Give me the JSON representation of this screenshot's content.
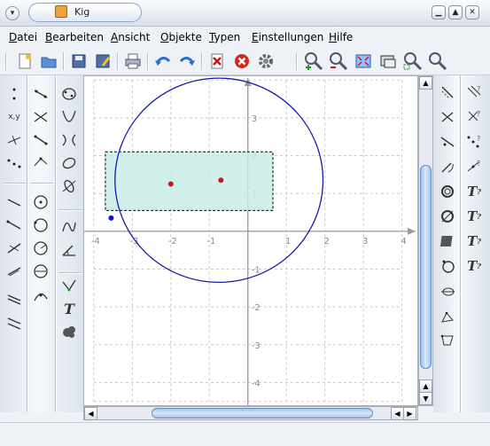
{
  "window": {
    "title": "Kig",
    "controls": [
      "minimize-icon",
      "maximize-icon",
      "close-icon"
    ]
  },
  "menu": [
    "Datei",
    "Bearbeiten",
    "Ansicht",
    "Objekte",
    "Typen",
    "Einstellungen",
    "Hilfe"
  ],
  "toolbar": {
    "buttons": [
      "new-document-icon",
      "open-icon",
      "save-icon",
      "save-as-icon",
      "print-icon",
      "undo-icon",
      "redo-icon",
      "delete-objects-icon",
      "cancel-construction-icon",
      "run-macro-icon",
      "zoom-in-icon",
      "zoom-out-icon",
      "full-screen-icon",
      "recenter-icon",
      "zoom-area-icon",
      "zoom-fit-icon"
    ]
  },
  "tool_glyphs": {
    "text_label": "T",
    "coordinates_label": "x,y"
  },
  "colors": {
    "circle": "#1a1aa8",
    "polygon_fill": "#c9ece8",
    "polygon_border": "#000000",
    "point_red": "#d01414",
    "point_blue": "#1414d0",
    "grid": "#c8c8c8",
    "axes": "#9a9a9a"
  },
  "plot": {
    "x_ticks": [
      "-4",
      "-3",
      "-2",
      "-1",
      "1",
      "2",
      "3",
      "4"
    ],
    "y_ticks": [
      "3",
      "2",
      "1",
      "-1",
      "-2",
      "-3",
      "-4"
    ],
    "xlim": [
      -4.25,
      4.4
    ],
    "ylim": [
      -4.6,
      4.1
    ],
    "grid": true,
    "circle": {
      "cx": -0.75,
      "cy": 1.35,
      "r": 2.7
    },
    "rectangle": {
      "x1": -3.7,
      "y1": 0.55,
      "x2": 0.65,
      "y2": 2.1
    },
    "points": [
      {
        "x": -2.0,
        "y": 1.25,
        "color": "red"
      },
      {
        "x": -0.7,
        "y": 1.35,
        "color": "red"
      },
      {
        "x": -3.55,
        "y": 0.35,
        "color": "blue"
      }
    ]
  }
}
